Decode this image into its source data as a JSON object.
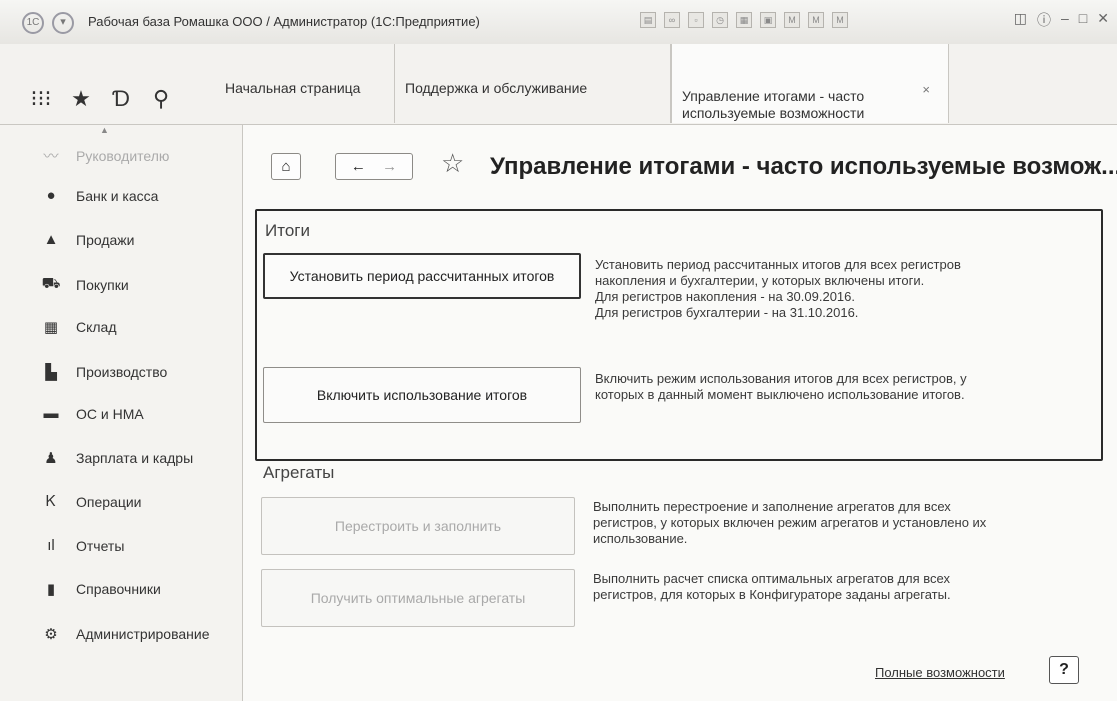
{
  "window": {
    "title": "Рабочая база Ромашка ООО / Администратор  (1С:Предприятие)"
  },
  "toolbar_icons": [
    "apps-grid-icon",
    "star-icon",
    "history-icon",
    "search-icon"
  ],
  "tabs": [
    {
      "label": "Начальная страница"
    },
    {
      "label": "Поддержка и обслуживание"
    },
    {
      "label": "Управление итогами - часто используемые возможности",
      "active": true
    }
  ],
  "sidebar": {
    "items": [
      {
        "label": "Руководителю",
        "icon": "chart-icon"
      },
      {
        "label": "Банк и касса",
        "icon": "coin-icon"
      },
      {
        "label": "Продажи",
        "icon": "bag-icon"
      },
      {
        "label": "Покупки",
        "icon": "cart-icon"
      },
      {
        "label": "Склад",
        "icon": "warehouse-icon"
      },
      {
        "label": "Производство",
        "icon": "factory-icon"
      },
      {
        "label": "ОС и НМА",
        "icon": "truck-icon"
      },
      {
        "label": "Зарплата и кадры",
        "icon": "people-icon"
      },
      {
        "label": "Операции",
        "icon": "operations-icon"
      },
      {
        "label": "Отчеты",
        "icon": "bar-chart-icon"
      },
      {
        "label": "Справочники",
        "icon": "book-icon"
      },
      {
        "label": "Администрирование",
        "icon": "gear-icon"
      }
    ]
  },
  "page": {
    "title": "Управление итогами - часто используемые возмож...",
    "close": "×"
  },
  "totals": {
    "title": "Итоги",
    "set_period_button": "Установить период рассчитанных итогов",
    "set_period_desc": [
      "Установить период рассчитанных итогов для всех регистров",
      "накопления и бухгалтерии, у которых включены итоги.",
      "Для регистров накопления - на 30.09.2016.",
      "Для регистров бухгалтерии - на 31.10.2016."
    ],
    "enable_button": "Включить использование итогов",
    "enable_desc": [
      "Включить режим использования итогов для всех регистров, у",
      "которых в данный момент выключено использование итогов."
    ]
  },
  "aggregates": {
    "title": "Агрегаты",
    "rebuild_button": "Перестроить и заполнить",
    "rebuild_desc": [
      "Выполнить  перестроение и заполнение агрегатов для всех",
      "регистров, у которых включен режим агрегатов и установлено их",
      "использование."
    ],
    "optimal_button": "Получить оптимальные агрегаты",
    "optimal_desc": [
      "Выполнить расчет списка оптимальных агрегатов для всех",
      "регистров, для которых в Конфигураторе заданы агрегаты."
    ]
  },
  "footer": {
    "full_link": "Полные возможности",
    "help": "?"
  }
}
